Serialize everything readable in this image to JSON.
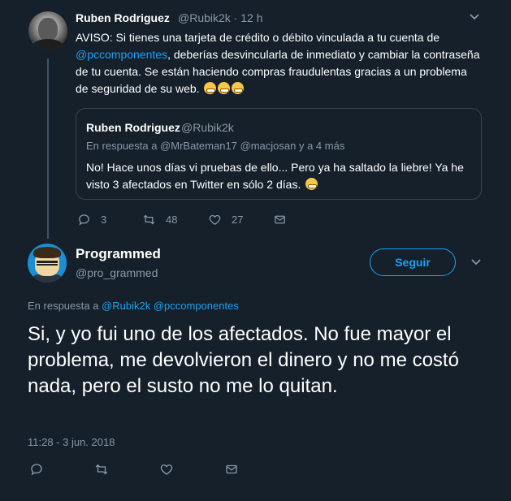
{
  "tweet1": {
    "author_name": "Ruben Rodriguez",
    "handle_time": "@Rubik2k · 12 h",
    "text_part1": "AVISO: Si tienes una tarjeta de crédito o débito vinculada a tu cuenta de",
    "mention": "@pccomponentes",
    "text_part2": ", deberías desvincularla de inmediato y cambiar la contraseña de tu cuenta. Se están haciendo compras fraudulentas gracias a un problema de seguridad de su web.",
    "quote": {
      "author_name": "Ruben Rodriguez",
      "handle": "@Rubik2k",
      "reply_context": "En respuesta a @MrBateman17 @macjosan y a 4 más",
      "text": "No! Hace unos días vi pruebas de ello... Pero ya ha saltado la liebre! Ya he visto 3 afectados en Twitter en sólo 2 días."
    },
    "actions": {
      "replies": "3",
      "retweets": "48",
      "likes": "27"
    }
  },
  "tweet2": {
    "author_name": "Programmed",
    "handle": "@pro_grammed",
    "follow_label": "Seguir",
    "reply_prefix": "En respuesta a ",
    "reply_mentions": "@Rubik2k @pccomponentes",
    "text": "Si, y yo fui uno de los afectados. No fue mayor el problema, me devolvieron el dinero y no me costó nada, pero el susto no me lo quitan.",
    "timestamp": "11:28 - 3 jun. 2018"
  },
  "icons": {
    "reply": "reply-icon",
    "retweet": "retweet-icon",
    "like": "heart-icon",
    "message": "envelope-icon",
    "menu": "chevron-down-icon"
  },
  "colors": {
    "background": "#15202b",
    "accent": "#1da1f2",
    "muted": "#8899a6",
    "border": "#38444d"
  }
}
